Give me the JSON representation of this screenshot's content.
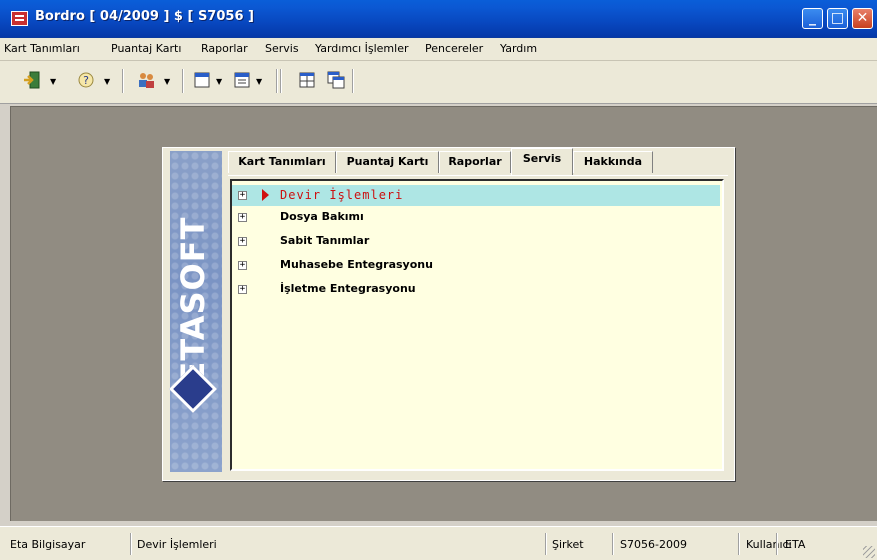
{
  "window": {
    "title": "Bordro [ 04/2009 ] $ [ S7056 ]",
    "buttons": [
      "minimize",
      "maximize",
      "close"
    ]
  },
  "menubar": {
    "items": [
      "Kart Tanımları",
      "Puantaj Kartı",
      "Raporlar",
      "Servis",
      "Yardımcı İşlemler",
      "Pencereler",
      "Yardım"
    ]
  },
  "toolbar": {
    "icons": [
      "exit-icon",
      "help-icon",
      "users-icon",
      "window-icon",
      "window-list-icon",
      "grid-icon",
      "cascade-icon"
    ]
  },
  "panel": {
    "logo_text": "ETASOFT",
    "tabs": [
      "Kart Tanımları",
      "Puantaj Kartı",
      "Raporlar",
      "Servis",
      "Hakkında"
    ],
    "active_tab": "Servis",
    "tree_items": [
      "Devir İşlemleri",
      "Dosya Bakımı",
      "Sabit Tanımlar",
      "Muhasebe Entegrasyonu",
      "İşletme Entegrasyonu"
    ],
    "selected_item": "Devir İşlemleri"
  },
  "statusbar": {
    "company": "Eta Bilgisayar",
    "operation": "Devir İşlemleri",
    "sirket_label": "Şirket",
    "sirket_value": "S7056-2009",
    "kullanici_label": "Kullanıcı",
    "kullanici_value": "ETA"
  },
  "colors": {
    "titlebar": "#0a5ed8",
    "mdi_background": "#918c82",
    "tree_background": "#ffffe1",
    "selection": "#aee6e4",
    "selected_text": "#cc1010"
  }
}
